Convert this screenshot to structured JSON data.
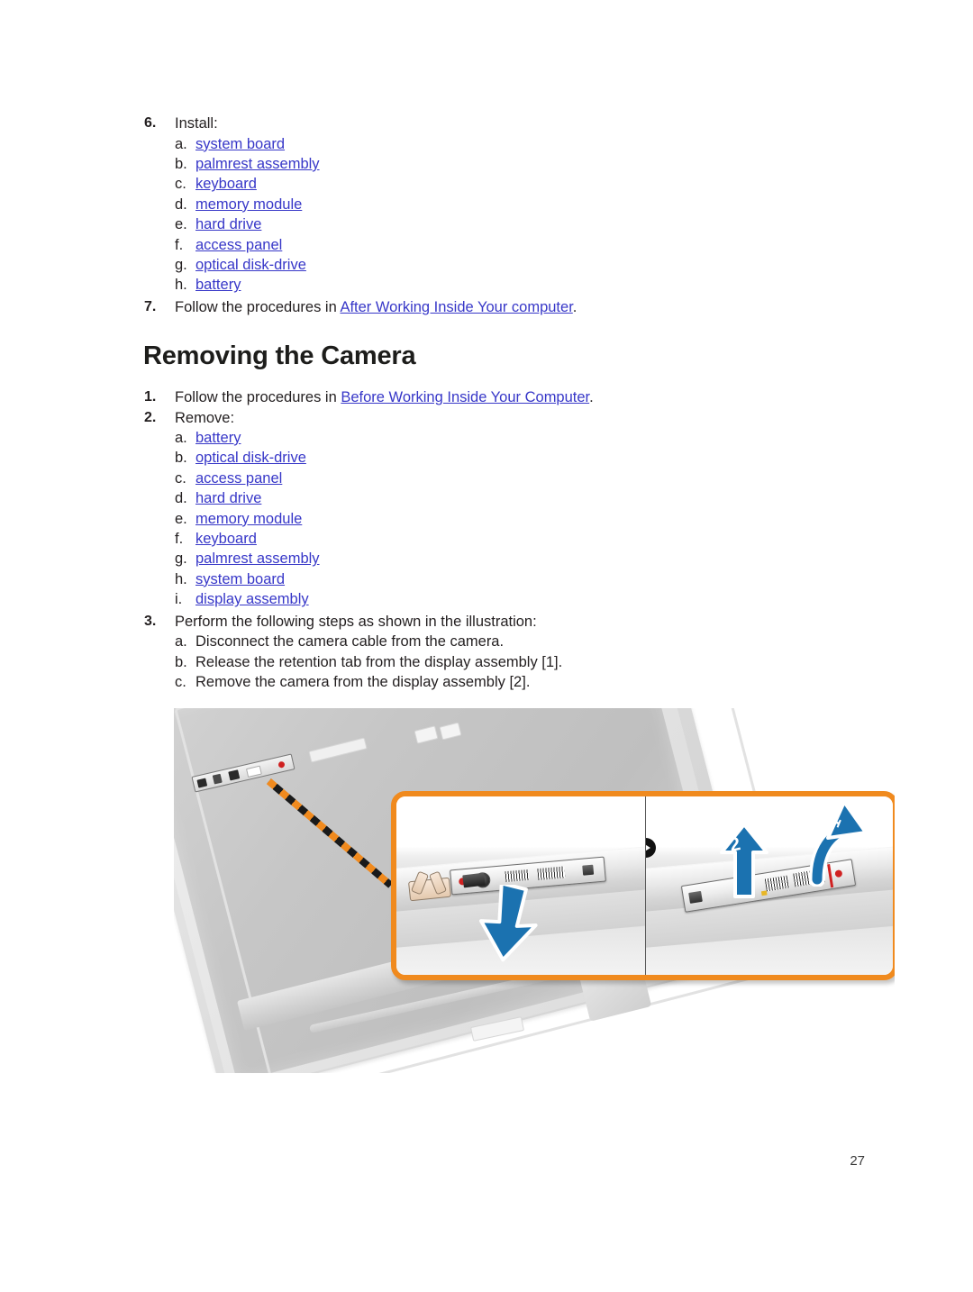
{
  "document": {
    "page_number": "27"
  },
  "install_section": {
    "step_number": "6.",
    "step_text": "Install:",
    "items": [
      {
        "marker": "a.",
        "label": "system board",
        "link": true
      },
      {
        "marker": "b.",
        "label": "palmrest assembly",
        "link": true
      },
      {
        "marker": "c.",
        "label": "keyboard",
        "link": true
      },
      {
        "marker": "d.",
        "label": "memory module",
        "link": true
      },
      {
        "marker": "e.",
        "label": "hard drive",
        "link": true
      },
      {
        "marker": "f.",
        "label": "access panel",
        "link": true
      },
      {
        "marker": "g.",
        "label": "optical disk-drive",
        "link": true
      },
      {
        "marker": "h.",
        "label": "battery",
        "link": true
      }
    ],
    "step7_number": "7.",
    "step7_prefix": "Follow the procedures in ",
    "step7_link": "After Working Inside Your computer",
    "step7_suffix": "."
  },
  "heading": "Removing the Camera",
  "removing_section": {
    "step1_number": "1.",
    "step1_prefix": "Follow the procedures in ",
    "step1_link": "Before Working Inside Your Computer",
    "step1_suffix": ".",
    "step2_number": "2.",
    "step2_text": "Remove:",
    "remove_items": [
      {
        "marker": "a.",
        "label": "battery",
        "link": true
      },
      {
        "marker": "b.",
        "label": "optical disk-drive",
        "link": true
      },
      {
        "marker": "c.",
        "label": "access panel",
        "link": true
      },
      {
        "marker": "d.",
        "label": "hard drive",
        "link": true
      },
      {
        "marker": "e.",
        "label": "memory module",
        "link": true
      },
      {
        "marker": "f.",
        "label": "keyboard",
        "link": true
      },
      {
        "marker": "g.",
        "label": "palmrest assembly",
        "link": true
      },
      {
        "marker": "h.",
        "label": "system board",
        "link": true
      },
      {
        "marker": "i.",
        "label": "display assembly",
        "link": true
      }
    ],
    "step3_number": "3.",
    "step3_text": "Perform the following steps as shown in the illustration:",
    "perform_items": [
      {
        "marker": "a.",
        "label": "Disconnect the camera cable from the camera.",
        "link": false
      },
      {
        "marker": "b.",
        "label": "Release the retention tab from the display assembly [1].",
        "link": false
      },
      {
        "marker": "c.",
        "label": "Remove the camera from the display assembly [2].",
        "link": false
      }
    ]
  },
  "illustration": {
    "alt": "Display assembly with camera module, zoomed callout showing cable disconnect and camera removal",
    "callout_step_labels": [
      "1",
      "2"
    ],
    "colors": {
      "callout_border": "#f08a1e",
      "arrow_blue": "#1b72b0",
      "leader_dash_orange": "#f08a1e",
      "leader_dash_dark": "#1a1a1a",
      "link_blue": "#3737c8"
    }
  }
}
